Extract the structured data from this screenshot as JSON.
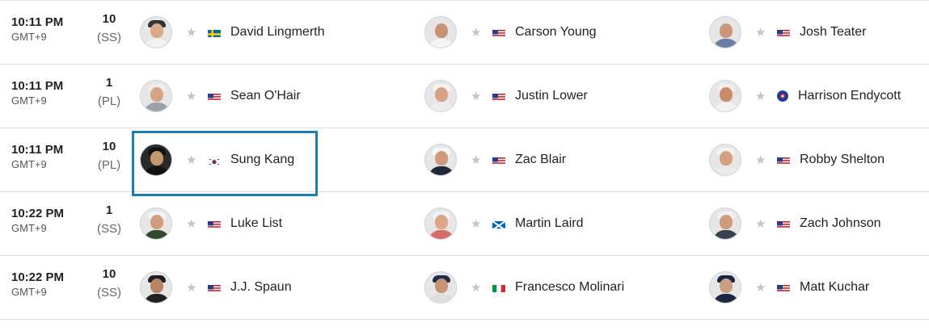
{
  "rows": [
    {
      "time": "10:11 PM",
      "tz": "GMT+9",
      "tee": "10",
      "course": "(SS)",
      "players": [
        {
          "name": "David Lingmerth",
          "flag": "SWE"
        },
        {
          "name": "Carson Young",
          "flag": "USA"
        },
        {
          "name": "Josh Teater",
          "flag": "USA"
        }
      ]
    },
    {
      "time": "10:11 PM",
      "tz": "GMT+9",
      "tee": "1",
      "course": "(PL)",
      "players": [
        {
          "name": "Sean O'Hair",
          "flag": "USA"
        },
        {
          "name": "Justin Lower",
          "flag": "USA"
        },
        {
          "name": "Harrison Endycott",
          "flag": "AUS"
        }
      ]
    },
    {
      "time": "10:11 PM",
      "tz": "GMT+9",
      "tee": "10",
      "course": "(PL)",
      "players": [
        {
          "name": "Sung Kang",
          "flag": "KOR"
        },
        {
          "name": "Zac Blair",
          "flag": "USA"
        },
        {
          "name": "Robby Shelton",
          "flag": "USA"
        }
      ]
    },
    {
      "time": "10:22 PM",
      "tz": "GMT+9",
      "tee": "1",
      "course": "(SS)",
      "players": [
        {
          "name": "Luke List",
          "flag": "USA"
        },
        {
          "name": "Martin Laird",
          "flag": "SCO"
        },
        {
          "name": "Zach Johnson",
          "flag": "USA"
        }
      ]
    },
    {
      "time": "10:22 PM",
      "tz": "GMT+9",
      "tee": "10",
      "course": "(SS)",
      "players": [
        {
          "name": "J.J. Spaun",
          "flag": "USA"
        },
        {
          "name": "Francesco Molinari",
          "flag": "ITA"
        },
        {
          "name": "Matt Kuchar",
          "flag": "USA"
        }
      ]
    }
  ],
  "icons": {
    "favorite": "star-icon",
    "avatar": "player-headshot"
  },
  "colors": {
    "star": "#c4c4c4",
    "highlight": "#1a7fb1",
    "divider": "#dcdcdc"
  }
}
